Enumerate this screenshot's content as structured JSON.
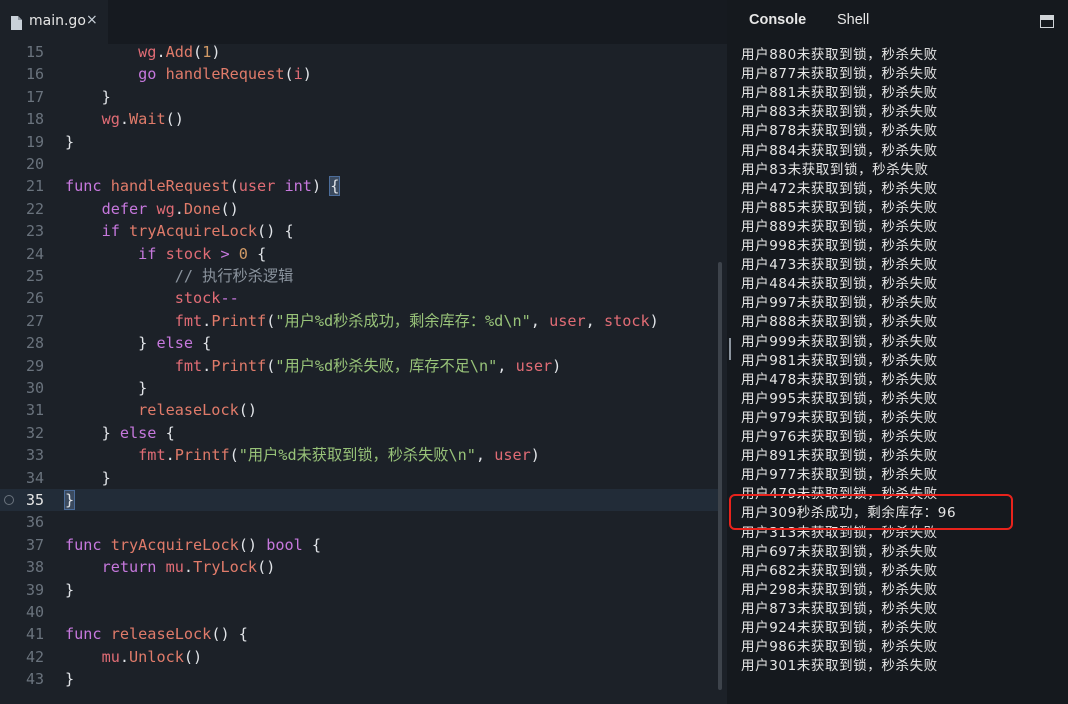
{
  "tab": {
    "filename": "main.go",
    "close_glyph": "×"
  },
  "lines": [
    {
      "n": "15",
      "tokens": [
        [
          "pl",
          "        "
        ],
        [
          "var",
          "wg"
        ],
        [
          "pl",
          "."
        ],
        [
          "fn",
          "Add"
        ],
        [
          "pl",
          "("
        ],
        [
          "num",
          "1"
        ],
        [
          "pl",
          ")"
        ]
      ]
    },
    {
      "n": "16",
      "tokens": [
        [
          "pl",
          "        "
        ],
        [
          "kw",
          "go"
        ],
        [
          "pl",
          " "
        ],
        [
          "fn",
          "handleRequest"
        ],
        [
          "pl",
          "("
        ],
        [
          "var",
          "i"
        ],
        [
          "pl",
          ")"
        ]
      ]
    },
    {
      "n": "17",
      "tokens": [
        [
          "pl",
          "    }"
        ]
      ]
    },
    {
      "n": "18",
      "tokens": [
        [
          "pl",
          "    "
        ],
        [
          "var",
          "wg"
        ],
        [
          "pl",
          "."
        ],
        [
          "fn",
          "Wait"
        ],
        [
          "pl",
          "()"
        ]
      ]
    },
    {
      "n": "19",
      "tokens": [
        [
          "pl",
          "}"
        ]
      ]
    },
    {
      "n": "20",
      "tokens": []
    },
    {
      "n": "21",
      "tokens": [
        [
          "kw",
          "func"
        ],
        [
          "pl",
          " "
        ],
        [
          "fn",
          "handleRequest"
        ],
        [
          "pl",
          "("
        ],
        [
          "var",
          "user"
        ],
        [
          "pl",
          " "
        ],
        [
          "typ",
          "int"
        ],
        [
          "pl",
          ") "
        ],
        [
          "brk",
          "{"
        ]
      ]
    },
    {
      "n": "22",
      "tokens": [
        [
          "pl",
          "    "
        ],
        [
          "kw",
          "defer"
        ],
        [
          "pl",
          " "
        ],
        [
          "var",
          "wg"
        ],
        [
          "pl",
          "."
        ],
        [
          "fn",
          "Done"
        ],
        [
          "pl",
          "()"
        ]
      ]
    },
    {
      "n": "23",
      "tokens": [
        [
          "pl",
          "    "
        ],
        [
          "kw",
          "if"
        ],
        [
          "pl",
          " "
        ],
        [
          "fn",
          "tryAcquireLock"
        ],
        [
          "pl",
          "() {"
        ]
      ]
    },
    {
      "n": "24",
      "tokens": [
        [
          "pl",
          "        "
        ],
        [
          "kw",
          "if"
        ],
        [
          "pl",
          " "
        ],
        [
          "var",
          "stock"
        ],
        [
          "pl",
          " "
        ],
        [
          "kw",
          ">"
        ],
        [
          "pl",
          " "
        ],
        [
          "num",
          "0"
        ],
        [
          "pl",
          " {"
        ]
      ]
    },
    {
      "n": "25",
      "tokens": [
        [
          "pl",
          "            "
        ],
        [
          "cm",
          "// 执行秒杀逻辑"
        ]
      ]
    },
    {
      "n": "26",
      "tokens": [
        [
          "pl",
          "            "
        ],
        [
          "var",
          "stock"
        ],
        [
          "kw",
          "--"
        ]
      ]
    },
    {
      "n": "27",
      "tokens": [
        [
          "pl",
          "            "
        ],
        [
          "var",
          "fmt"
        ],
        [
          "pl",
          "."
        ],
        [
          "fn",
          "Printf"
        ],
        [
          "pl",
          "("
        ],
        [
          "str",
          "\"用户%d秒杀成功，剩余库存：%d\\n\""
        ],
        [
          "pl",
          ", "
        ],
        [
          "var",
          "user"
        ],
        [
          "pl",
          ", "
        ],
        [
          "var",
          "stock"
        ],
        [
          "pl",
          ")"
        ]
      ]
    },
    {
      "n": "28",
      "tokens": [
        [
          "pl",
          "        } "
        ],
        [
          "kw",
          "else"
        ],
        [
          "pl",
          " {"
        ]
      ]
    },
    {
      "n": "29",
      "tokens": [
        [
          "pl",
          "            "
        ],
        [
          "var",
          "fmt"
        ],
        [
          "pl",
          "."
        ],
        [
          "fn",
          "Printf"
        ],
        [
          "pl",
          "("
        ],
        [
          "str",
          "\"用户%d秒杀失败，库存不足\\n\""
        ],
        [
          "pl",
          ", "
        ],
        [
          "var",
          "user"
        ],
        [
          "pl",
          ")"
        ]
      ]
    },
    {
      "n": "30",
      "tokens": [
        [
          "pl",
          "        }"
        ]
      ]
    },
    {
      "n": "31",
      "tokens": [
        [
          "pl",
          "        "
        ],
        [
          "fn",
          "releaseLock"
        ],
        [
          "pl",
          "()"
        ]
      ]
    },
    {
      "n": "32",
      "tokens": [
        [
          "pl",
          "    } "
        ],
        [
          "kw",
          "else"
        ],
        [
          "pl",
          " {"
        ]
      ]
    },
    {
      "n": "33",
      "tokens": [
        [
          "pl",
          "        "
        ],
        [
          "var",
          "fmt"
        ],
        [
          "pl",
          "."
        ],
        [
          "fn",
          "Printf"
        ],
        [
          "pl",
          "("
        ],
        [
          "str",
          "\"用户%d未获取到锁，秒杀失败\\n\""
        ],
        [
          "pl",
          ", "
        ],
        [
          "var",
          "user"
        ],
        [
          "pl",
          ")"
        ]
      ]
    },
    {
      "n": "34",
      "tokens": [
        [
          "pl",
          "    }"
        ]
      ]
    },
    {
      "n": "35",
      "tokens": [
        [
          "brk",
          "}"
        ]
      ],
      "active": true
    },
    {
      "n": "36",
      "tokens": []
    },
    {
      "n": "37",
      "tokens": [
        [
          "kw",
          "func"
        ],
        [
          "pl",
          " "
        ],
        [
          "fn",
          "tryAcquireLock"
        ],
        [
          "pl",
          "() "
        ],
        [
          "typ",
          "bool"
        ],
        [
          "pl",
          " {"
        ]
      ]
    },
    {
      "n": "38",
      "tokens": [
        [
          "pl",
          "    "
        ],
        [
          "kw",
          "return"
        ],
        [
          "pl",
          " "
        ],
        [
          "var",
          "mu"
        ],
        [
          "pl",
          "."
        ],
        [
          "fn",
          "TryLock"
        ],
        [
          "pl",
          "()"
        ]
      ]
    },
    {
      "n": "39",
      "tokens": [
        [
          "pl",
          "}"
        ]
      ]
    },
    {
      "n": "40",
      "tokens": []
    },
    {
      "n": "41",
      "tokens": [
        [
          "kw",
          "func"
        ],
        [
          "pl",
          " "
        ],
        [
          "fn",
          "releaseLock"
        ],
        [
          "pl",
          "() {"
        ]
      ]
    },
    {
      "n": "42",
      "tokens": [
        [
          "pl",
          "    "
        ],
        [
          "var",
          "mu"
        ],
        [
          "pl",
          "."
        ],
        [
          "fn",
          "Unlock"
        ],
        [
          "pl",
          "()"
        ]
      ]
    },
    {
      "n": "43",
      "tokens": [
        [
          "pl",
          "}"
        ]
      ]
    }
  ],
  "panel": {
    "tab_console": "Console",
    "tab_shell": "Shell"
  },
  "console_lines": [
    "用户880未获取到锁，秒杀失败",
    "用户877未获取到锁，秒杀失败",
    "用户881未获取到锁，秒杀失败",
    "用户883未获取到锁，秒杀失败",
    "用户878未获取到锁，秒杀失败",
    "用户884未获取到锁，秒杀失败",
    "用户83未获取到锁，秒杀失败",
    "用户472未获取到锁，秒杀失败",
    "用户885未获取到锁，秒杀失败",
    "用户889未获取到锁，秒杀失败",
    "用户998未获取到锁，秒杀失败",
    "用户473未获取到锁，秒杀失败",
    "用户484未获取到锁，秒杀失败",
    "用户997未获取到锁，秒杀失败",
    "用户888未获取到锁，秒杀失败",
    "用户999未获取到锁，秒杀失败",
    "用户981未获取到锁，秒杀失败",
    "用户478未获取到锁，秒杀失败",
    "用户995未获取到锁，秒杀失败",
    "用户979未获取到锁，秒杀失败",
    "用户976未获取到锁，秒杀失败",
    "用户891未获取到锁，秒杀失败",
    "用户977未获取到锁，秒杀失败",
    "用户479未获取到锁，秒杀失败",
    "用户309秒杀成功，剩余库存：96",
    "用户313未获取到锁，秒杀失败",
    "用户697未获取到锁，秒杀失败",
    "用户682未获取到锁，秒杀失败",
    "用户298未获取到锁，秒杀失败",
    "用户873未获取到锁，秒杀失败",
    "用户924未获取到锁，秒杀失败",
    "用户986未获取到锁，秒杀失败",
    "用户301未获取到锁，秒杀失败"
  ],
  "highlighted_console_line": 24,
  "colors": {
    "highlight_box": "#e8231c",
    "keyword": "#c678dd",
    "string": "#98c379",
    "function": "#e07b6a"
  }
}
